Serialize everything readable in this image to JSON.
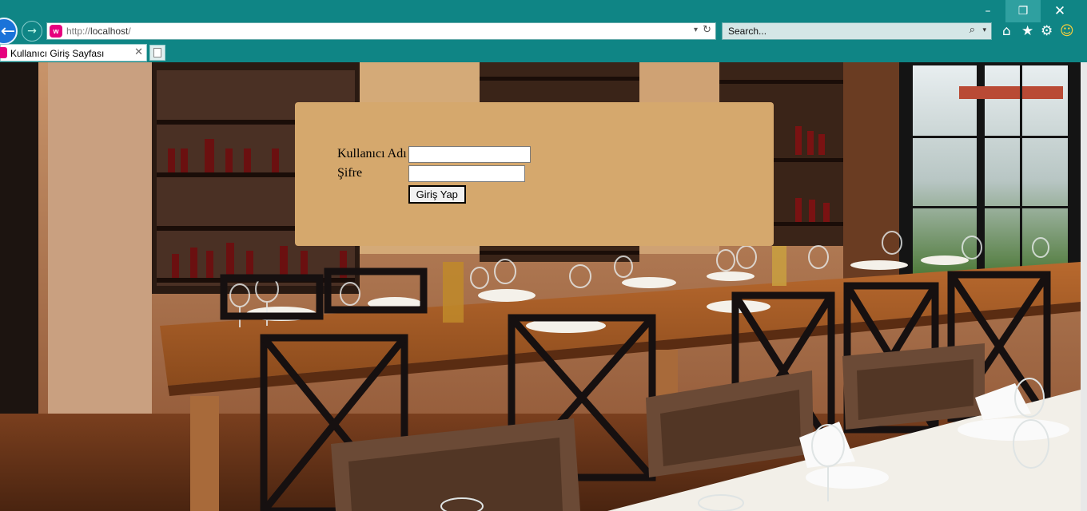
{
  "window_controls": {
    "minimize": "–",
    "restore": "❐",
    "close": "✕"
  },
  "nav": {
    "back_glyph": "←",
    "forward_glyph": "→"
  },
  "address_bar": {
    "protocol": "http://",
    "host": "localhost",
    "path": "/",
    "site_icon_letter": "w",
    "dropdown_glyph": "▾",
    "refresh_glyph": "↻"
  },
  "search_box": {
    "placeholder": "Search...",
    "icon_glyph": "⌕",
    "dropdown_glyph": "▾"
  },
  "toolbar": {
    "home_glyph": "⌂",
    "favorites_glyph": "★",
    "tools_glyph": "⚙",
    "feedback_glyph": "☺"
  },
  "tab": {
    "title": "Kullanıcı Giriş Sayfası",
    "close_glyph": "✕"
  },
  "login_form": {
    "username_label": "Kullanıcı Adı",
    "username_value": "",
    "password_label": "Şifre",
    "password_value": "",
    "submit_label": "Giriş Yap"
  },
  "colors": {
    "chrome": "#0f8585",
    "panel": "#d5a86d",
    "back_button": "#1a73d9",
    "site_icon": "#e6007e"
  }
}
